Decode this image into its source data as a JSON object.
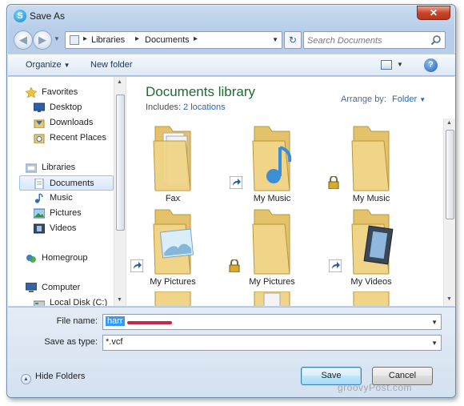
{
  "window": {
    "title": "Save As",
    "close_label": "✕"
  },
  "nav": {
    "breadcrumb": [
      "Libraries",
      "Documents"
    ],
    "search_placeholder": "Search Documents"
  },
  "toolbar": {
    "organize_label": "Organize",
    "new_folder_label": "New folder"
  },
  "sidebar": {
    "items": [
      {
        "label": "Favorites",
        "icon": "star-icon"
      },
      {
        "label": "Desktop",
        "icon": "desktop-icon"
      },
      {
        "label": "Downloads",
        "icon": "downloads-icon"
      },
      {
        "label": "Recent Places",
        "icon": "recent-places-icon"
      },
      {
        "label": "Libraries",
        "icon": "libraries-icon"
      },
      {
        "label": "Documents",
        "icon": "documents-icon",
        "selected": true
      },
      {
        "label": "Music",
        "icon": "music-icon"
      },
      {
        "label": "Pictures",
        "icon": "pictures-icon"
      },
      {
        "label": "Videos",
        "icon": "videos-icon"
      },
      {
        "label": "Homegroup",
        "icon": "homegroup-icon"
      },
      {
        "label": "Computer",
        "icon": "computer-icon"
      },
      {
        "label": "Local Disk (C:)",
        "icon": "disk-icon"
      }
    ]
  },
  "library": {
    "title": "Documents library",
    "includes_label": "Includes:",
    "includes_link": "2 locations",
    "arrange_label": "Arrange by:",
    "arrange_value": "Folder"
  },
  "files": [
    {
      "label": "Fax",
      "type": "folder",
      "overlay": "none",
      "content": "papers"
    },
    {
      "label": "My Music",
      "type": "folder",
      "overlay": "shortcut",
      "content": "music-note"
    },
    {
      "label": "My Music",
      "type": "folder",
      "overlay": "lock",
      "content": "none"
    },
    {
      "label": "My Pictures",
      "type": "folder",
      "overlay": "shortcut",
      "content": "picture"
    },
    {
      "label": "My Pictures",
      "type": "folder",
      "overlay": "lock",
      "content": "none"
    },
    {
      "label": "My Videos",
      "type": "folder",
      "overlay": "shortcut",
      "content": "filmstrip"
    }
  ],
  "form": {
    "filename_label": "File name:",
    "filename_value": "harr",
    "savetype_label": "Save as type:",
    "savetype_value": "*.vcf"
  },
  "footer": {
    "hide_folders_label": "Hide Folders",
    "save_label": "Save",
    "cancel_label": "Cancel",
    "watermark": "groovyPost.com"
  },
  "colors": {
    "library_title": "#1e6b2f",
    "link": "#2a66b3",
    "selection": "#3399ff"
  }
}
